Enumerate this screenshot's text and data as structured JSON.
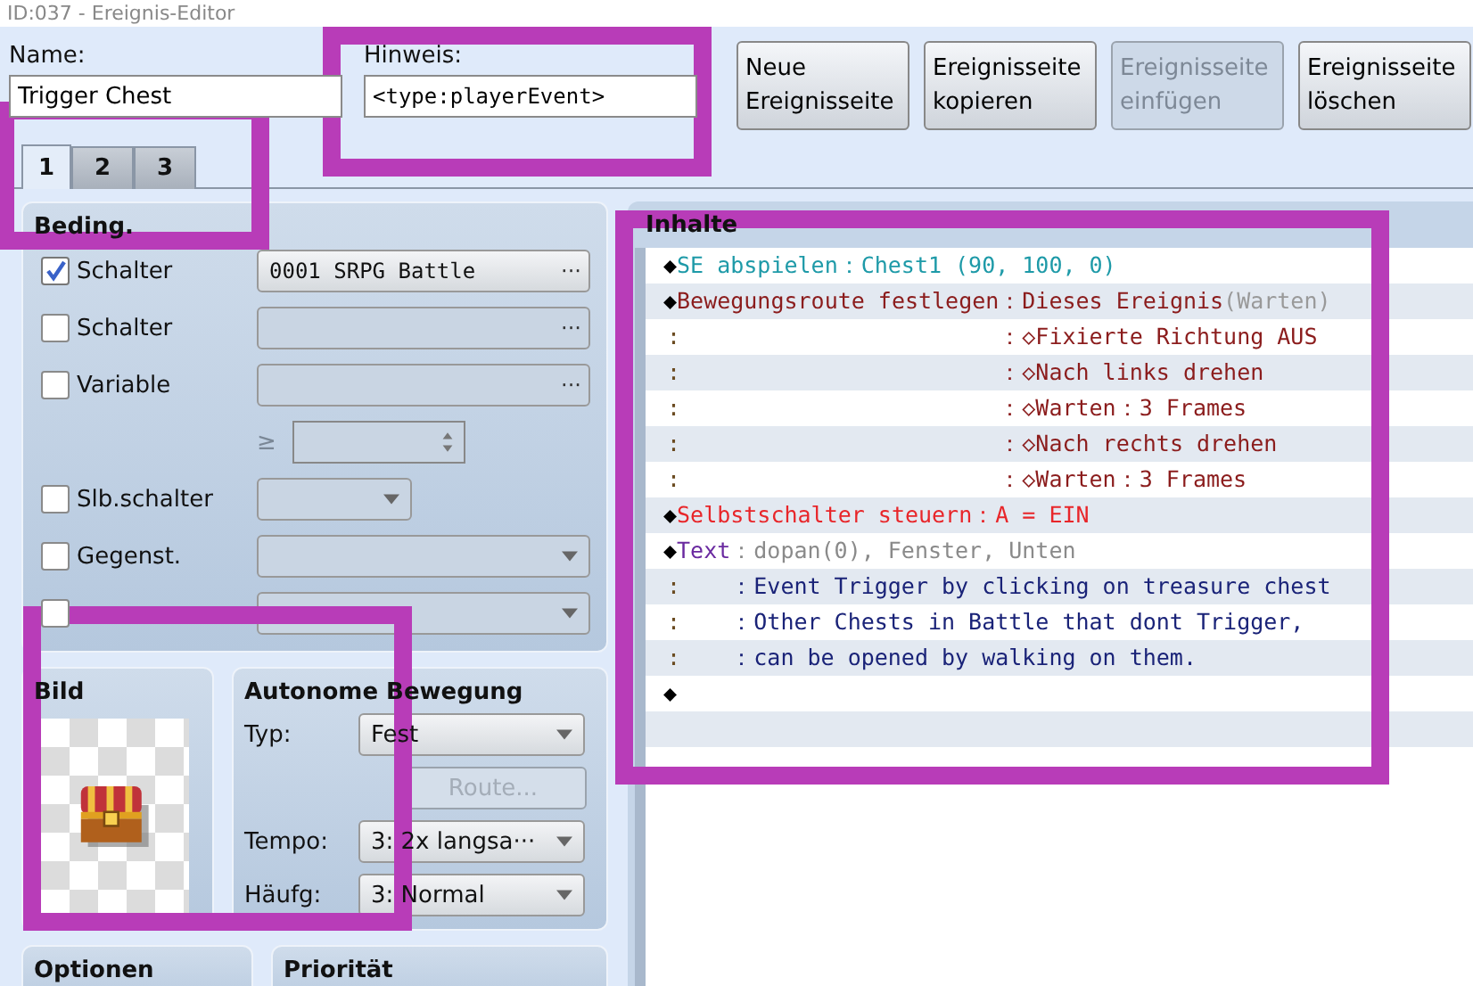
{
  "window": {
    "title": "ID:037 - Ereignis-Editor"
  },
  "name_field": {
    "label": "Name:",
    "value": "Trigger Chest"
  },
  "hint_field": {
    "label": "Hinweis:",
    "value": "<type:playerEvent>"
  },
  "buttons": [
    {
      "lines": [
        "Neue",
        "Ereignisseite"
      ],
      "disabled": false
    },
    {
      "lines": [
        "Ereignisseite",
        "kopieren"
      ],
      "disabled": false
    },
    {
      "lines": [
        "Ereignisseite",
        "einfügen"
      ],
      "disabled": true
    },
    {
      "lines": [
        "Ereignisseite",
        "löschen"
      ],
      "disabled": false
    }
  ],
  "tabs": [
    {
      "label": "1",
      "selected": true
    },
    {
      "label": "2",
      "selected": false
    },
    {
      "label": "3",
      "selected": false
    }
  ],
  "conditions": {
    "title": "Beding.",
    "rows": [
      {
        "kind": "picker",
        "label": "Schalter",
        "checked": true,
        "value": "0001 SRPG Battle",
        "button": "···"
      },
      {
        "kind": "picker",
        "label": "Schalter",
        "checked": false,
        "button": "···"
      },
      {
        "kind": "picker",
        "label": "Variable",
        "checked": false,
        "button": "···"
      },
      {
        "kind": "compare",
        "symbol": "≥"
      },
      {
        "kind": "select",
        "label": "Slb.schalter",
        "checked": false,
        "short": true
      },
      {
        "kind": "select",
        "label": "Gegenst.",
        "checked": false,
        "short": false
      },
      {
        "kind": "select",
        "checked": false,
        "short": false
      }
    ]
  },
  "image": {
    "title": "Bild"
  },
  "movement": {
    "title": "Autonome Bewegung",
    "type_label": "Typ:",
    "type_value": "Fest",
    "route_button": "Route...",
    "speed_label": "Tempo:",
    "speed_value": "3: 2x langsa···",
    "freq_label": "Häufg:",
    "freq_value": "3: Normal"
  },
  "options": {
    "title": "Optionen"
  },
  "priority": {
    "title": "Priorität"
  },
  "contents": {
    "title": "Inhalte",
    "commands": [
      {
        "kind": "command",
        "name": "SE abspielen",
        "color": "#1e9aa8",
        "lines": [
          {
            "marker": "◆",
            "args": "：Chest1 (90, 100, 0)",
            "color": "#1e9aa8"
          }
        ]
      },
      {
        "kind": "command",
        "name": "Bewegungsroute festlegen",
        "color": "#8b1c1c",
        "lines": [
          {
            "marker": "◆",
            "args": "：Dieses Ereignis",
            "note": "(Warten)",
            "color": "#8b1c1c"
          },
          {
            "marker": ":",
            "args": "：◇Fixierte Richtung AUS",
            "color": "#8b1c1c"
          },
          {
            "marker": ":",
            "args": "：◇Nach links drehen",
            "color": "#8b1c1c"
          },
          {
            "marker": ":",
            "args": "：◇Warten：3 Frames",
            "color": "#8b1c1c"
          },
          {
            "marker": ":",
            "args": "：◇Nach rechts drehen",
            "color": "#8b1c1c"
          },
          {
            "marker": ":",
            "args": "：◇Warten：3 Frames",
            "color": "#8b1c1c"
          }
        ]
      },
      {
        "kind": "command",
        "name": "Selbstschalter steuern",
        "color": "#e8262a",
        "lines": [
          {
            "marker": "◆",
            "args": "：A = EIN",
            "color": "#e8262a"
          }
        ]
      },
      {
        "kind": "command",
        "name": "Text",
        "color": "#6a2aa0",
        "lines": [
          {
            "marker": "◆",
            "args": "：dopan(0), Fenster, Unten",
            "color": "#8a8a8a"
          },
          {
            "marker": ":",
            "args": "：Event Trigger by clicking on treasure chest",
            "color": "#1a2378"
          },
          {
            "marker": ":",
            "args": "：Other Chests in Battle that dont Trigger,",
            "color": "#1a2378"
          },
          {
            "marker": ":",
            "args": "：can be opened by walking on them.",
            "color": "#1a2378"
          }
        ]
      },
      {
        "kind": "end",
        "lines": [
          {
            "marker": "◆"
          }
        ]
      }
    ]
  }
}
